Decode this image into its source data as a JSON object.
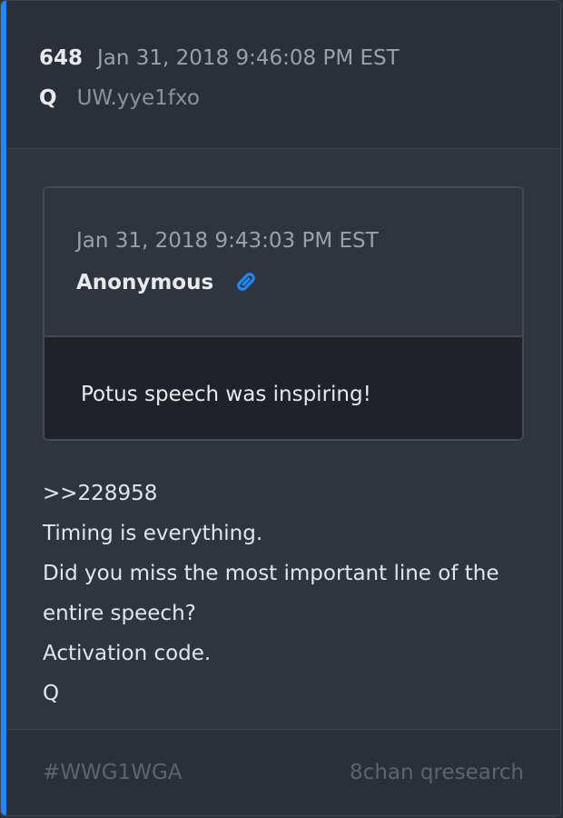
{
  "post": {
    "number": "648",
    "timestamp": "Jan 31, 2018 9:46:08 PM EST",
    "author": "Q",
    "tripcode": "UW.yye1fxo"
  },
  "quoted_post": {
    "timestamp": "Jan 31, 2018 9:43:03 PM EST",
    "author": "Anonymous",
    "link_icon": "link-icon",
    "text": "Potus speech was inspiring!"
  },
  "message": {
    "lines": [
      ">>228958",
      "Timing is everything.",
      "Did you miss the most important line of the",
      "entire speech?",
      "Activation code.",
      "Q"
    ]
  },
  "footer": {
    "tag": "#WWG1WGA",
    "source": "8chan qresearch"
  },
  "colors": {
    "accent": "#1e88ff",
    "link_icon": "#1e88ff"
  }
}
